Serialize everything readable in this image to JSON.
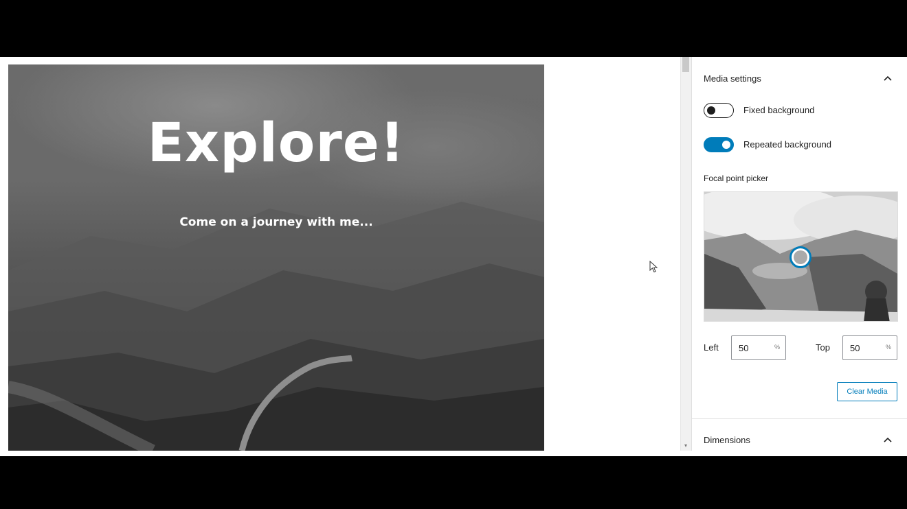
{
  "cover": {
    "title": "Explore!",
    "subtitle": "Come on a journey with me..."
  },
  "sidebar": {
    "media_settings": {
      "title": "Media settings",
      "expanded": true,
      "fixed_background": {
        "label": "Fixed background",
        "checked": false
      },
      "repeated_background": {
        "label": "Repeated background",
        "checked": true
      },
      "focal_point": {
        "label": "Focal point picker",
        "left": {
          "label": "Left",
          "value": "50",
          "unit": "%"
        },
        "top": {
          "label": "Top",
          "value": "50",
          "unit": "%"
        }
      },
      "clear_media_label": "Clear Media"
    },
    "dimensions": {
      "title": "Dimensions",
      "expanded": true
    }
  },
  "colors": {
    "accent": "#007cba",
    "letterbox": "#000000"
  },
  "icons": [
    "chevron-up-icon",
    "mouse-cursor-icon",
    "focal-point-handle"
  ]
}
